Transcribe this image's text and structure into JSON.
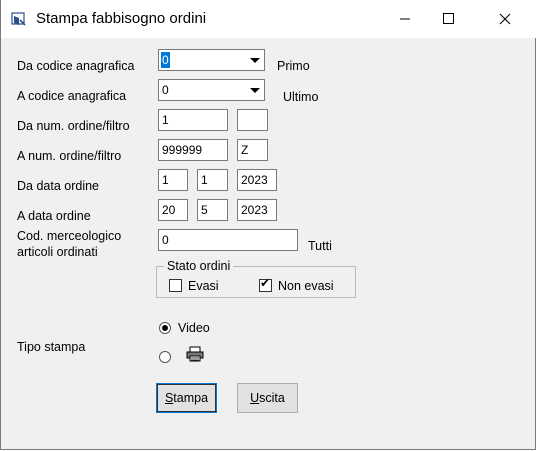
{
  "window": {
    "title": "Stampa fabbisogno ordini",
    "icons": {
      "app": "app-icon",
      "minimize": "minimize-icon",
      "maximize": "maximize-icon",
      "close": "close-icon"
    }
  },
  "form": {
    "da_codice": {
      "label": "Da codice anagrafica",
      "value": "0",
      "hint": "Primo"
    },
    "a_codice": {
      "label": "A codice anagrafica",
      "value": "0",
      "hint": "Ultimo"
    },
    "da_num": {
      "label": "Da num. ordine/filtro",
      "value": "1",
      "filter": ""
    },
    "a_num": {
      "label": "A num. ordine/filtro",
      "value": "999999",
      "filter": "Z"
    },
    "da_data": {
      "label": "Da data ordine",
      "day": "1",
      "month": "1",
      "year": "2023"
    },
    "a_data": {
      "label": "A data ordine",
      "day": "20",
      "month": "5",
      "year": "2023"
    },
    "cod_merc": {
      "label_line1": "Cod. merceologico",
      "label_line2": "articoli ordinati",
      "value": "0",
      "hint": "Tutti"
    },
    "stato": {
      "title": "Stato ordini",
      "evasi": {
        "label": "Evasi",
        "checked": false
      },
      "non_evasi": {
        "label": "Non evasi",
        "checked": true
      }
    },
    "tipo_stampa": {
      "label": "Tipo stampa",
      "video": {
        "label": "Video",
        "selected": true
      },
      "printer": {
        "icon": "printer-icon",
        "selected": false
      }
    }
  },
  "buttons": {
    "stampa": {
      "first": "S",
      "rest": "tampa"
    },
    "uscita": {
      "first": "U",
      "rest": "scita"
    }
  }
}
